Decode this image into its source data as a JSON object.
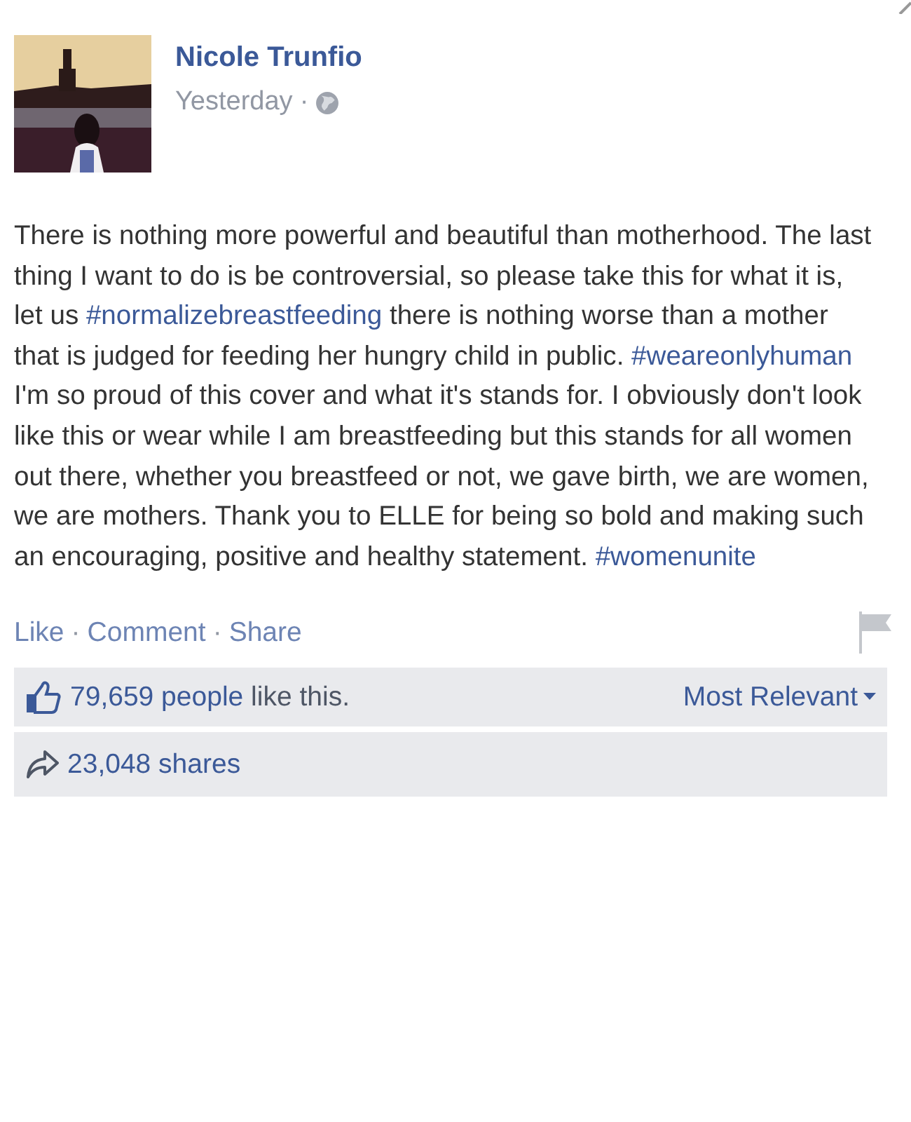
{
  "post": {
    "author": "Nicole Trunfio",
    "time": "Yesterday",
    "separator": "·",
    "body": [
      {
        "kind": "text",
        "text": "There is nothing more powerful and beautiful than motherhood. The last thing I want to do is be controversial, so please take this for what it is, let us "
      },
      {
        "kind": "hashtag",
        "text": "#normalizebreastfeeding"
      },
      {
        "kind": "text",
        "text": " there is nothing worse than a mother that is judged for feeding her hungry child in public. "
      },
      {
        "kind": "hashtag",
        "text": "#weareonlyhuman"
      },
      {
        "kind": "text",
        "text": " I'm so proud of this cover and what it's stands for. I obviously don't look like this or wear while I am breastfeeding but this stands for all women out there, whether you breastfeed or not, we gave birth, we are women, we are mothers. Thank you to ELLE for being so bold and making such an encouraging, positive and healthy statement. "
      },
      {
        "kind": "hashtag",
        "text": "#womenunite"
      }
    ]
  },
  "actions": [
    "Like",
    "Comment",
    "Share"
  ],
  "action_separator": "·",
  "likes": {
    "parts": [
      {
        "kind": "link",
        "text": "79,659 people"
      },
      {
        "kind": "text",
        "text": " like this."
      }
    ],
    "sort": "Most Relevant"
  },
  "shares": {
    "text": "23,048 shares"
  }
}
